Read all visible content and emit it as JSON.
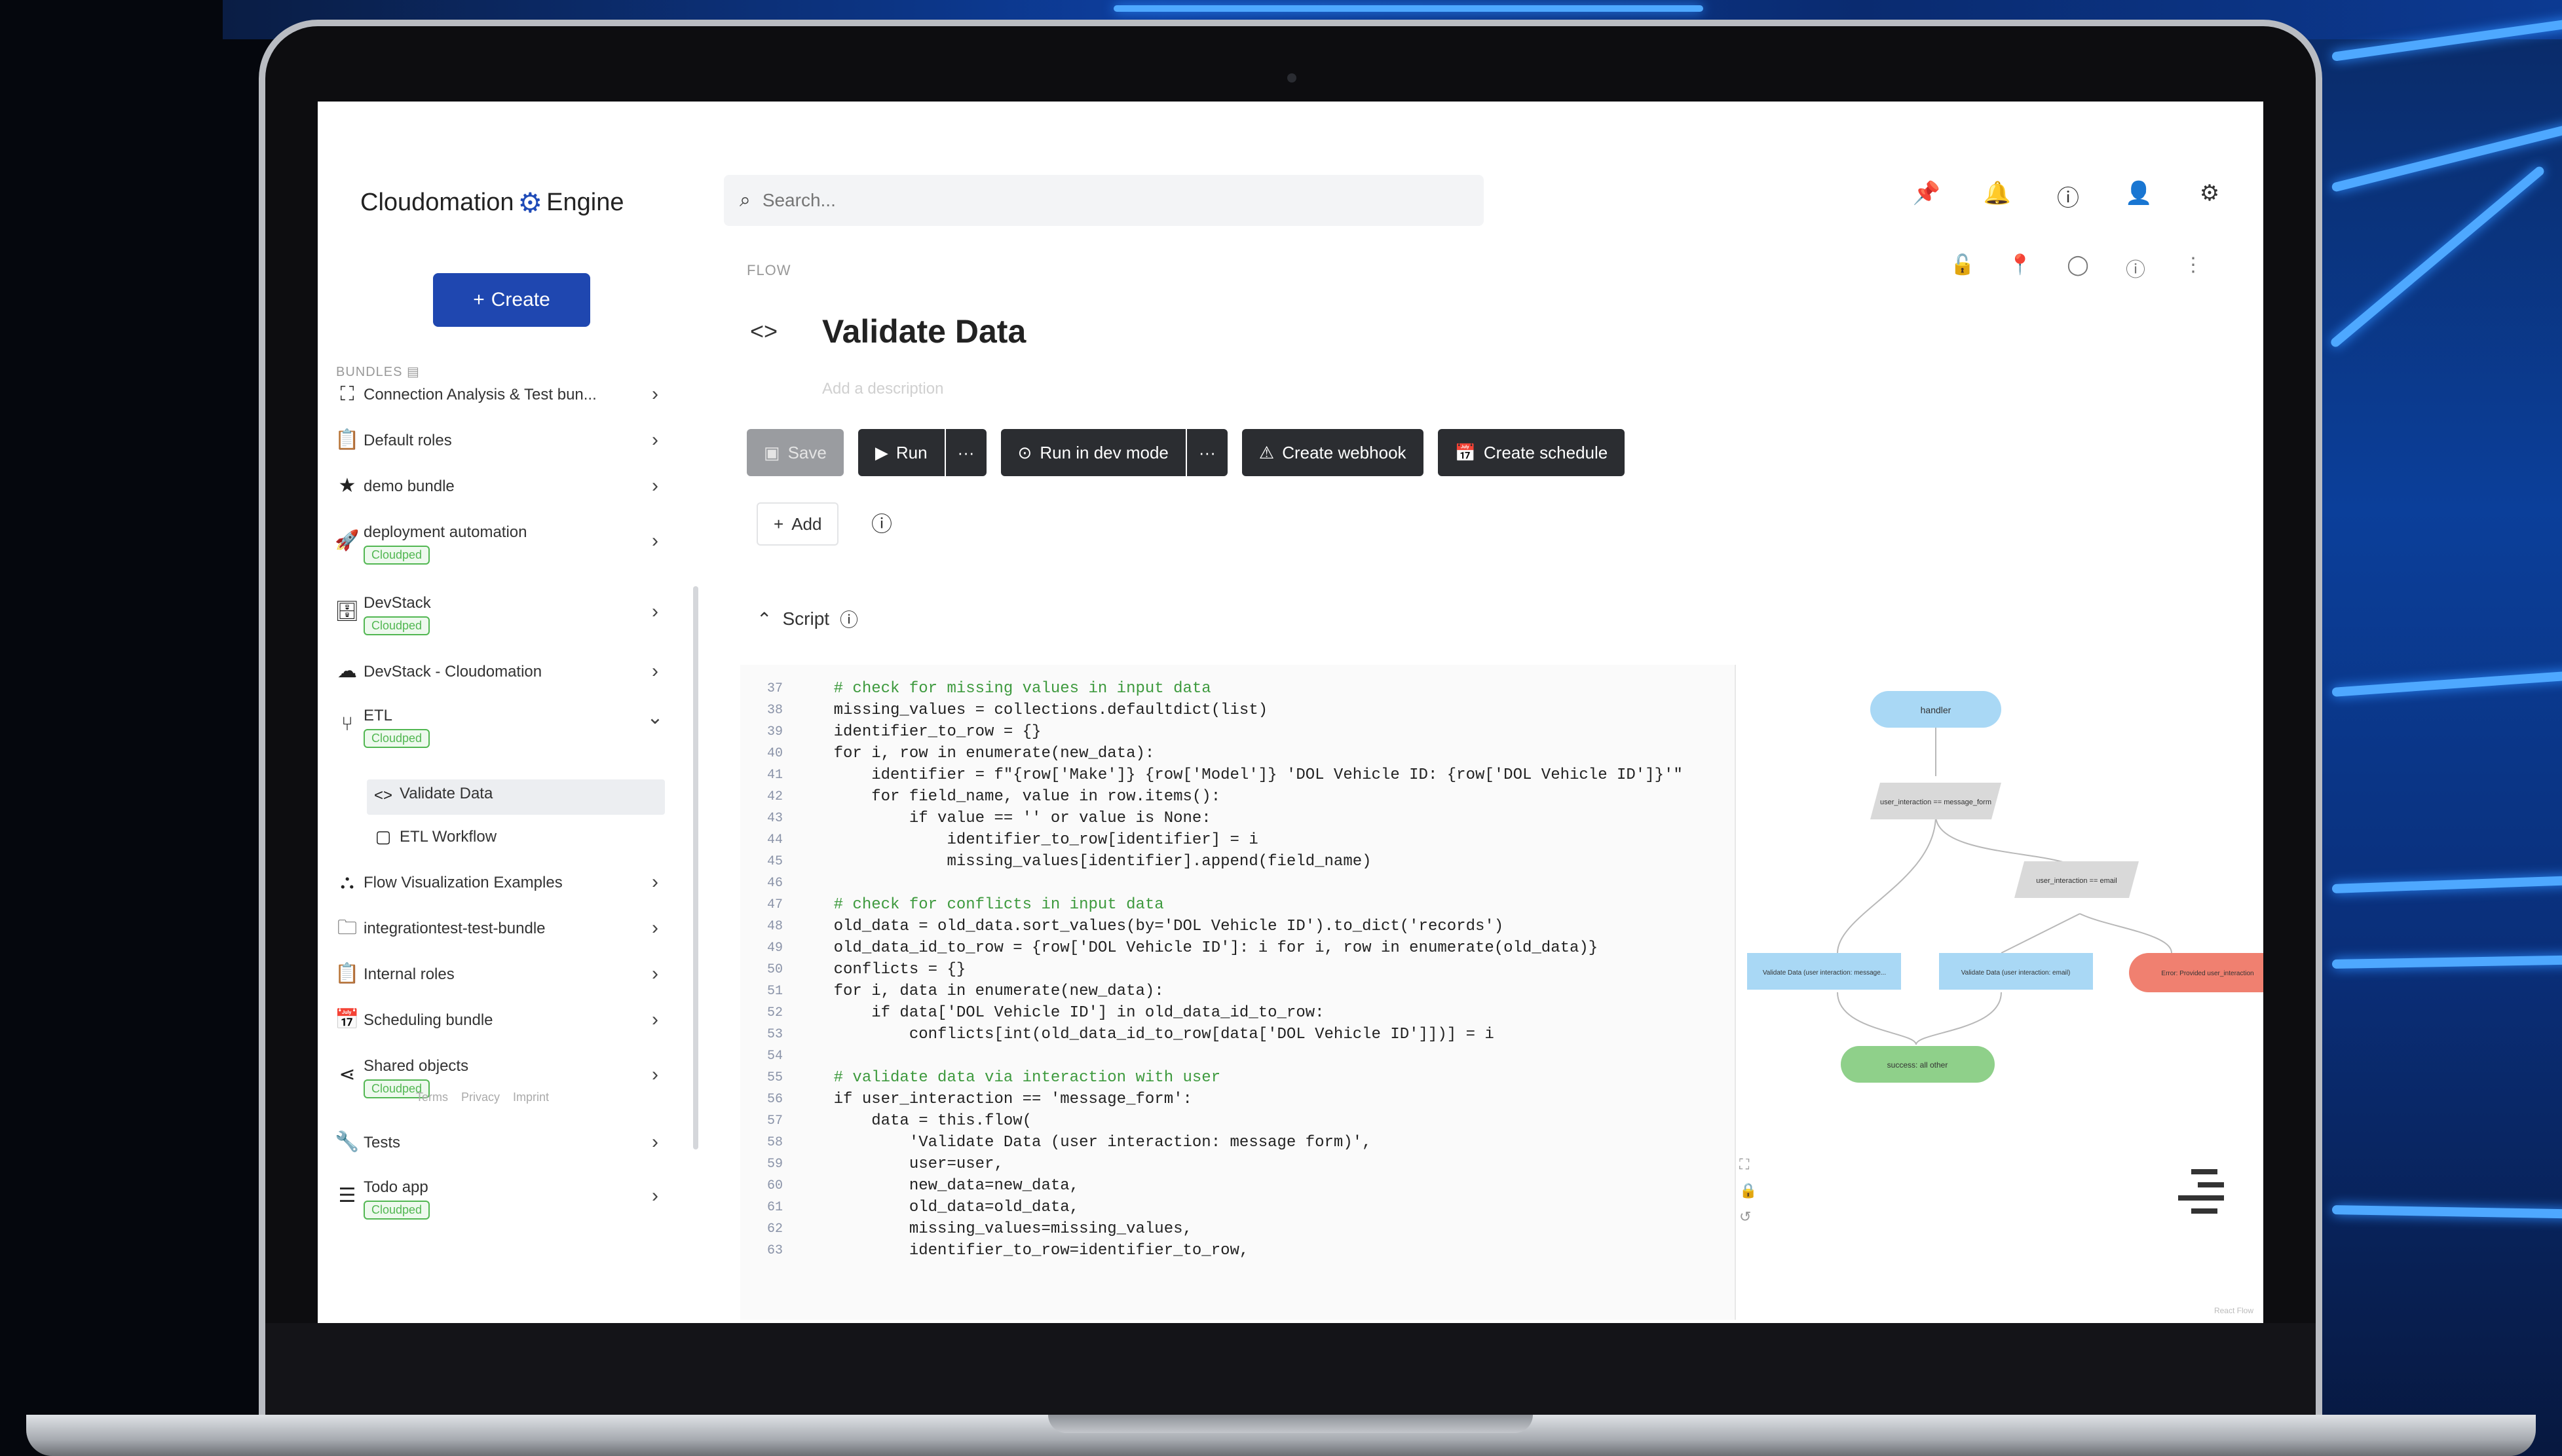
{
  "brand": {
    "name": "Cloudomation",
    "suffix": "Engine",
    "color": "#1f47b0"
  },
  "create_button": {
    "label": "Create",
    "icon": "plus-icon"
  },
  "search": {
    "placeholder": "Search..."
  },
  "top_icons": [
    "pin-icon",
    "bell-icon",
    "help-icon",
    "user-icon",
    "settings-icon"
  ],
  "object_icons": [
    "lock-icon",
    "pin-icon",
    "circle-icon",
    "info-icon",
    "more-icon"
  ],
  "sidebar": {
    "section_label": "BUNDLES",
    "items": [
      {
        "label": "Connection Analysis & Test bun...",
        "icon": "scan-icon",
        "badge": "",
        "chevron": ">"
      },
      {
        "label": "Default roles",
        "icon": "clipboard-icon",
        "badge": "",
        "chevron": ">"
      },
      {
        "label": "demo bundle",
        "icon": "star-icon",
        "badge": "",
        "chevron": ">"
      },
      {
        "label": "deployment automation",
        "icon": "rocket-icon",
        "badge": "Cloudped",
        "chevron": ">"
      },
      {
        "label": "DevStack",
        "icon": "database-icon",
        "badge": "Cloudped",
        "chevron": ">"
      },
      {
        "label": "DevStack - Cloudomation",
        "icon": "cloud-icon",
        "badge": "",
        "chevron": ">"
      },
      {
        "label": "ETL",
        "icon": "flow-icon",
        "badge": "Cloudped",
        "chevron": "v"
      },
      {
        "label": "Flow Visualization Examples",
        "icon": "graph-icon",
        "badge": "",
        "chevron": ">"
      },
      {
        "label": "integrationtest-test-bundle",
        "icon": "folder-icon",
        "badge": "",
        "chevron": ">"
      },
      {
        "label": "Internal roles",
        "icon": "clipboard-icon",
        "badge": "",
        "chevron": ">"
      },
      {
        "label": "Scheduling bundle",
        "icon": "calendar-icon",
        "badge": "",
        "chevron": ">"
      },
      {
        "label": "Shared objects",
        "icon": "share-icon",
        "badge": "Cloudped",
        "chevron": ">"
      },
      {
        "label": "Tests",
        "icon": "wrench-icon",
        "badge": "",
        "chevron": ">"
      },
      {
        "label": "Todo app",
        "icon": "list-icon",
        "badge": "Cloudped",
        "chevron": ">"
      }
    ],
    "sub_items": [
      {
        "label": "Validate Data",
        "icon": "code-icon"
      },
      {
        "label": "ETL Workflow",
        "icon": "calendar-icon"
      }
    ],
    "footer": [
      "Terms",
      "Privacy",
      "Imprint"
    ]
  },
  "main": {
    "breadcrumb": "FLOW",
    "title": "Validate Data",
    "description_placeholder": "Add a description",
    "toolbar": {
      "save": "Save",
      "run": "Run",
      "run_dev": "Run in dev mode",
      "webhook": "Create webhook",
      "schedule": "Create schedule",
      "more": "···"
    },
    "add_label": "Add",
    "script_label": "Script"
  },
  "code": {
    "lines": [
      {
        "n": "37",
        "t": "    # check for missing values in input data",
        "c": true
      },
      {
        "n": "38",
        "t": "    missing_values = collections.defaultdict(list)",
        "c": false
      },
      {
        "n": "39",
        "t": "    identifier_to_row = {}",
        "c": false
      },
      {
        "n": "40",
        "t": "    for i, row in enumerate(new_data):",
        "c": false
      },
      {
        "n": "41",
        "t": "        identifier = f\"{row['Make']} {row['Model']} 'DOL Vehicle ID: {row['DOL Vehicle ID']}'\"",
        "c": false
      },
      {
        "n": "42",
        "t": "        for field_name, value in row.items():",
        "c": false
      },
      {
        "n": "43",
        "t": "            if value == '' or value is None:",
        "c": false
      },
      {
        "n": "44",
        "t": "                identifier_to_row[identifier] = i",
        "c": false
      },
      {
        "n": "45",
        "t": "                missing_values[identifier].append(field_name)",
        "c": false
      },
      {
        "n": "46",
        "t": "",
        "c": false
      },
      {
        "n": "47",
        "t": "    # check for conflicts in input data",
        "c": true
      },
      {
        "n": "48",
        "t": "    old_data = old_data.sort_values(by='DOL Vehicle ID').to_dict('records')",
        "c": false
      },
      {
        "n": "49",
        "t": "    old_data_id_to_row = {row['DOL Vehicle ID']: i for i, row in enumerate(old_data)}",
        "c": false
      },
      {
        "n": "50",
        "t": "    conflicts = {}",
        "c": false
      },
      {
        "n": "51",
        "t": "    for i, data in enumerate(new_data):",
        "c": false
      },
      {
        "n": "52",
        "t": "        if data['DOL Vehicle ID'] in old_data_id_to_row:",
        "c": false
      },
      {
        "n": "53",
        "t": "            conflicts[int(old_data_id_to_row[data['DOL Vehicle ID']])] = i",
        "c": false
      },
      {
        "n": "54",
        "t": "",
        "c": false
      },
      {
        "n": "55",
        "t": "    # validate data via interaction with user",
        "c": true
      },
      {
        "n": "56",
        "t": "    if user_interaction == 'message_form':",
        "c": false
      },
      {
        "n": "57",
        "t": "        data = this.flow(",
        "c": false
      },
      {
        "n": "58",
        "t": "            'Validate Data (user interaction: message form)',",
        "c": false
      },
      {
        "n": "59",
        "t": "            user=user,",
        "c": false
      },
      {
        "n": "60",
        "t": "            new_data=new_data,",
        "c": false
      },
      {
        "n": "61",
        "t": "            old_data=old_data,",
        "c": false
      },
      {
        "n": "62",
        "t": "            missing_values=missing_values,",
        "c": false
      },
      {
        "n": "63",
        "t": "            identifier_to_row=identifier_to_row,",
        "c": false
      }
    ]
  },
  "flow_graph": {
    "nodes": [
      {
        "label": "handler",
        "color": "#a9d8f5"
      },
      {
        "label": "user_interaction == message_form",
        "color": "#d9d9d9"
      },
      {
        "label": "user_interaction == email",
        "color": "#d9d9d9"
      },
      {
        "label": "Validate Data (user interaction: message...",
        "color": "#a9d8f5"
      },
      {
        "label": "Validate Data (user interaction: email)",
        "color": "#a9d8f5"
      },
      {
        "label": "Error: Provided user_interaction",
        "color": "#f08070"
      },
      {
        "label": "success: all other",
        "color": "#8fd08a"
      }
    ],
    "watermark": "React Flow"
  }
}
